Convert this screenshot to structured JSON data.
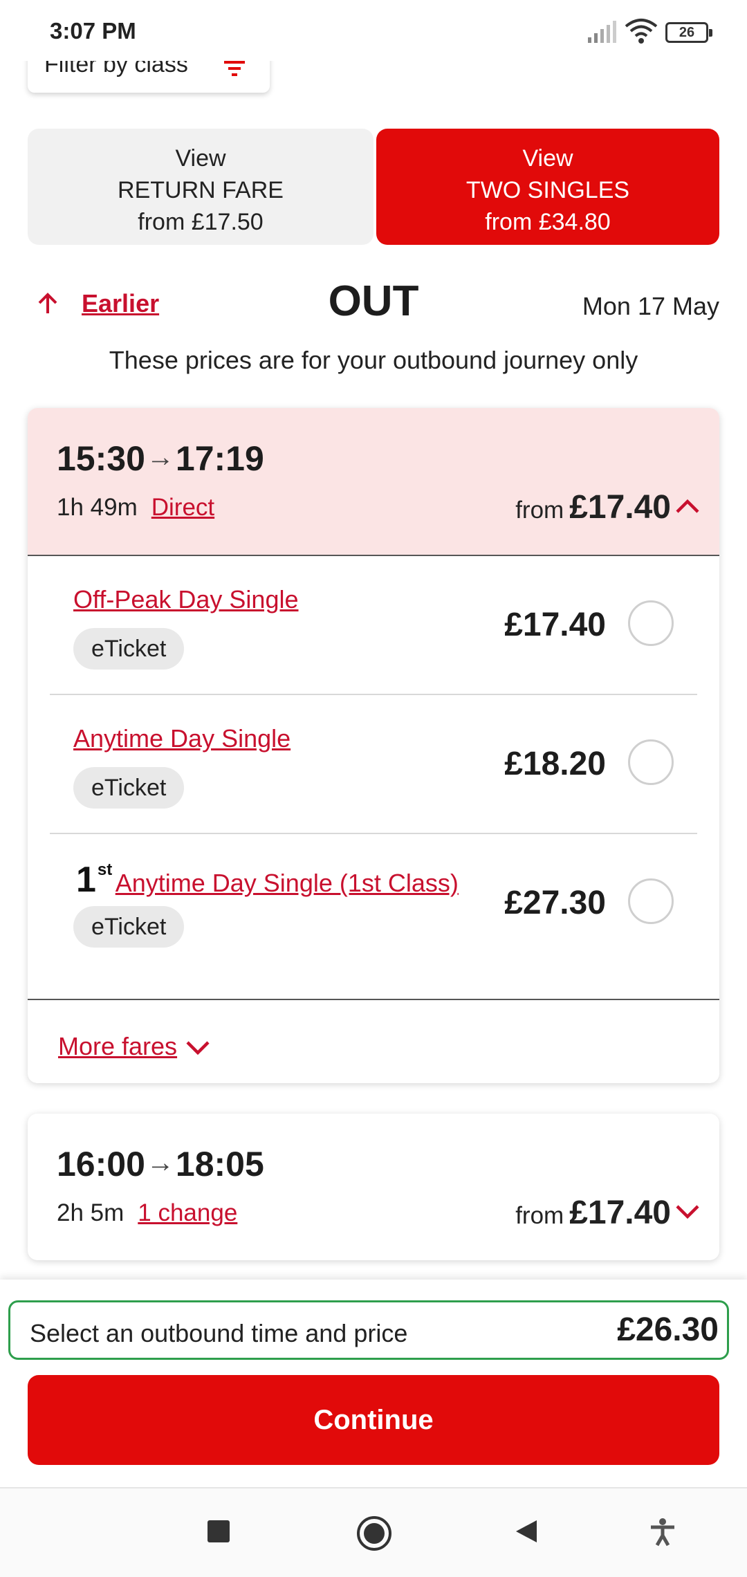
{
  "status_bar": {
    "time": "3:07 PM",
    "battery": "26",
    "icons": [
      "signal-icon",
      "wifi-icon",
      "battery-icon"
    ]
  },
  "filter": {
    "label": "Filter by class",
    "icon": "filter-icon"
  },
  "fare_toggle": {
    "return": {
      "line1": "View",
      "line2": "RETURN FARE",
      "line3": "from £17.50"
    },
    "singles": {
      "line1": "View",
      "line2": "TWO SINGLES",
      "line3": "from £34.80"
    },
    "selected": "singles"
  },
  "journey_header": {
    "earlier_label": "Earlier",
    "title": "OUT",
    "date": "Mon 17 May",
    "note": "These prices are for your outbound journey only"
  },
  "journeys": [
    {
      "depart": "15:30",
      "arrive": "17:19",
      "duration": "1h 49m",
      "changes": "Direct",
      "from_label": "from",
      "from_price": "£17.40",
      "expanded": true,
      "fares": [
        {
          "name": "Off-Peak Day Single",
          "ticket": "eTicket",
          "price": "£17.40",
          "first_class": false
        },
        {
          "name": "Anytime Day Single",
          "ticket": "eTicket",
          "price": "£18.20",
          "first_class": false
        },
        {
          "name": "Anytime Day Single (1st Class)",
          "ticket": "eTicket",
          "price": "£27.30",
          "first_class": true,
          "class_mark": "1",
          "class_sup": "st"
        }
      ],
      "more_fares": "More fares"
    },
    {
      "depart": "16:00",
      "arrive": "18:05",
      "duration": "2h 5m",
      "changes": "1 change",
      "from_label": "from",
      "from_price": "£17.40",
      "expanded": false
    }
  ],
  "summary": {
    "text": "Select an outbound time and price",
    "amount": "£26.30"
  },
  "continue_label": "Continue",
  "nav": [
    "recents-icon",
    "home-icon",
    "back-icon",
    "accessibility-icon"
  ],
  "colors": {
    "accent": "#e10a0a",
    "link": "#c8102e",
    "selected_row_bg": "#fbe4e4",
    "summary_border": "#2e9e4c"
  }
}
